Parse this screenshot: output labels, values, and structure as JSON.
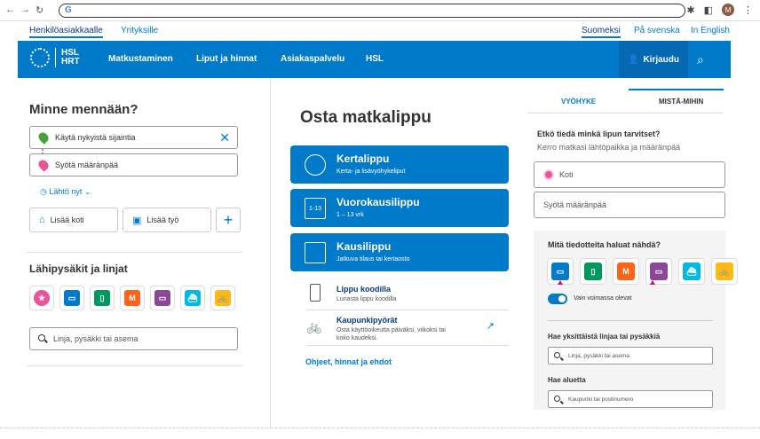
{
  "top_links": {
    "personal": "Henkilöasiakkaalle",
    "business": "Yrityksille",
    "lang_fi": "Suomeksi",
    "lang_sv": "På svenska",
    "lang_en": "In English"
  },
  "header": {
    "logo_line1": "HSL",
    "logo_line2": "HRT",
    "nav": [
      "Matkustaminen",
      "Liput ja hinnat",
      "Asiakaspalvelu",
      "HSL"
    ],
    "login": "Kirjaudu",
    "accent": "#007ac9"
  },
  "journey": {
    "title": "Minne mennään?",
    "origin_value": "Käytä nykyistä sijaintia",
    "destination_placeholder": "Syötä määränpää",
    "departure": "Lähtö nyt",
    "add_home": "Lisää koti",
    "add_work": "Lisää työ"
  },
  "stops": {
    "title": "Lähipysäkit ja linjat",
    "modes": [
      {
        "icon": "star-icon",
        "color": "#e85599"
      },
      {
        "icon": "bus-icon",
        "color": "#007ac9"
      },
      {
        "icon": "tram-icon",
        "color": "#00985f"
      },
      {
        "icon": "metro-icon",
        "color": "#ff6319",
        "letter": "M"
      },
      {
        "icon": "train-icon",
        "color": "#8c4799"
      },
      {
        "icon": "ferry-icon",
        "color": "#00b9e4"
      },
      {
        "icon": "citybike-icon",
        "color": "#fcb919"
      }
    ],
    "search_placeholder": "Linja, pysäkki tai asema"
  },
  "tickets": {
    "title": "Osta matkalippu",
    "items": [
      {
        "name": "Kertalippu",
        "sub": "Kerta- ja lisävyöhykeliput"
      },
      {
        "name": "Vuorokausilippu",
        "sub": "1 – 13 vrk",
        "icon_text": "1-13"
      },
      {
        "name": "Kausilippu",
        "sub": "Jatkuva tilaus tai kertaosto"
      }
    ],
    "app_title": "Lippu koodilla",
    "app_sub": "Lunasta lippu koodilla",
    "bikes_title": "Kaupunkipyörät",
    "bikes_sub1": "Osta käyttöoikeutta päiväksi, viikoksi tai",
    "bikes_sub2": "koko kaudeksi.",
    "help_link": "Ohjeet, hinnat ja ehdot"
  },
  "zone": {
    "tab_zone": "VYÖHYKE",
    "tab_route": "MISTÄ-MIHIN",
    "question": "Etkö tiedä minkä lipun tarvitset?",
    "hint": "Kerro matkasi lähtöpaikka ja määränpää",
    "origin": "Koti",
    "destination_placeholder": "Syötä määränpää",
    "info_title": "Mitä tiedotteita haluat nähdä?",
    "toggle_label": "Vain voimassa olevat",
    "single_label": "Hae yksittäistä linjaa tai pysäkkiä",
    "single_placeholder": "Linja, pysäkki tai asema",
    "area_label": "Hae aluetta",
    "area_placeholder": "Kaupunki tai postinumero"
  }
}
